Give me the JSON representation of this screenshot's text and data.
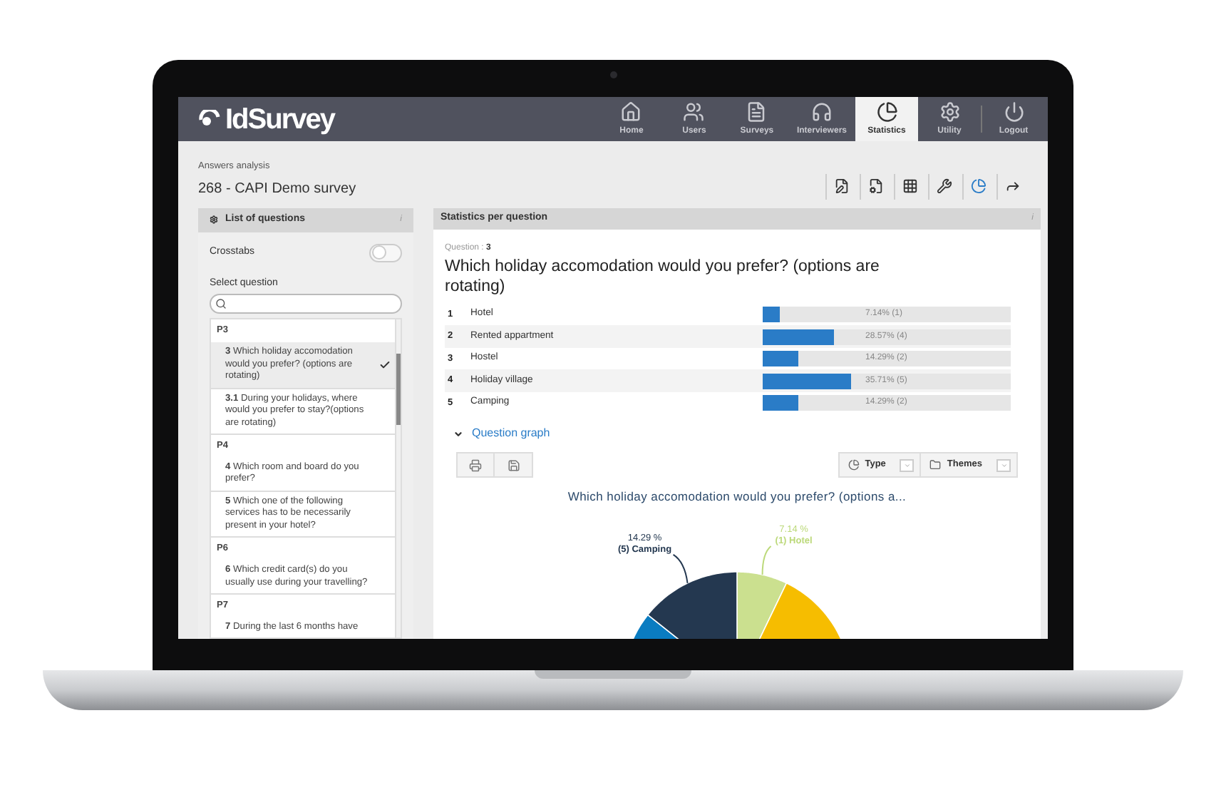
{
  "app": {
    "logo": "IdSurvey"
  },
  "nav": [
    {
      "label": "Home",
      "selected": false
    },
    {
      "label": "Users",
      "selected": false
    },
    {
      "label": "Surveys",
      "selected": false
    },
    {
      "label": "Interviewers",
      "selected": false
    },
    {
      "label": "Statistics",
      "selected": true
    },
    {
      "label": "Utility",
      "selected": false
    },
    {
      "label": "Logout",
      "selected": false
    }
  ],
  "header": {
    "subtitle": "Answers analysis",
    "title": "268 - CAPI Demo survey"
  },
  "toolbar": [
    {
      "selected": false
    },
    {
      "selected": false
    },
    {
      "selected": false
    },
    {
      "selected": false
    },
    {
      "selected": true
    },
    {
      "selected": false
    }
  ],
  "questions_panel": {
    "title": "List of questions",
    "info": "i",
    "crosstabs": {
      "label": "Crosstabs",
      "on": false
    },
    "select_label": "Select question",
    "groups": [
      {
        "name": "P3",
        "questions": [
          {
            "number": "3",
            "text": "Which holiday accomodation would you prefer? (options are rotating)",
            "selected": true
          },
          {
            "number": "3.1",
            "text": "During your holidays, where would you prefer to stay?(options are rotating)",
            "selected": false
          }
        ]
      },
      {
        "name": "P4",
        "questions": [
          {
            "number": "4",
            "text": "Which room and board do you prefer?",
            "selected": false
          },
          {
            "number": "5",
            "text": "Which one of the following services has to be necessarily present in your hotel?",
            "selected": false
          }
        ]
      },
      {
        "name": "P6",
        "questions": [
          {
            "number": "6",
            "text": "Which credit card(s) do you usually use during your travelling?",
            "selected": false
          }
        ]
      },
      {
        "name": "P7",
        "questions": [
          {
            "number": "7",
            "text": "During the last 6 months have",
            "selected": false
          }
        ]
      }
    ]
  },
  "stats_panel": {
    "title": "Statistics per question",
    "info": "i",
    "question_label": "Question :",
    "question_number": "3",
    "question_text": "Which holiday accomodation would you prefer? (options are rotating)",
    "answers": [
      {
        "number": "1",
        "label": "Hotel",
        "level": 0.0714,
        "reading": "7.14% (1)"
      },
      {
        "number": "2",
        "label": "Rented appartment",
        "level": 0.2857,
        "reading": "28.57% (4)"
      },
      {
        "number": "3",
        "label": "Hostel",
        "level": 0.1429,
        "reading": "14.29% (2)"
      },
      {
        "number": "4",
        "label": "Holiday village",
        "level": 0.3571,
        "reading": "35.71% (5)"
      },
      {
        "number": "5",
        "label": "Camping",
        "level": 0.1429,
        "reading": "14.29% (2)"
      }
    ],
    "graph": {
      "toggle": "Question graph",
      "expanded": true,
      "type_label": "Type",
      "themes_label": "Themes",
      "chart_title": "Which holiday accomodation would you prefer? (options a...",
      "slice_labels": [
        {
          "percent": "14.29 %",
          "name": "(5) Camping"
        },
        {
          "percent": "7.14 %",
          "name": "(1) Hotel"
        }
      ]
    }
  }
}
